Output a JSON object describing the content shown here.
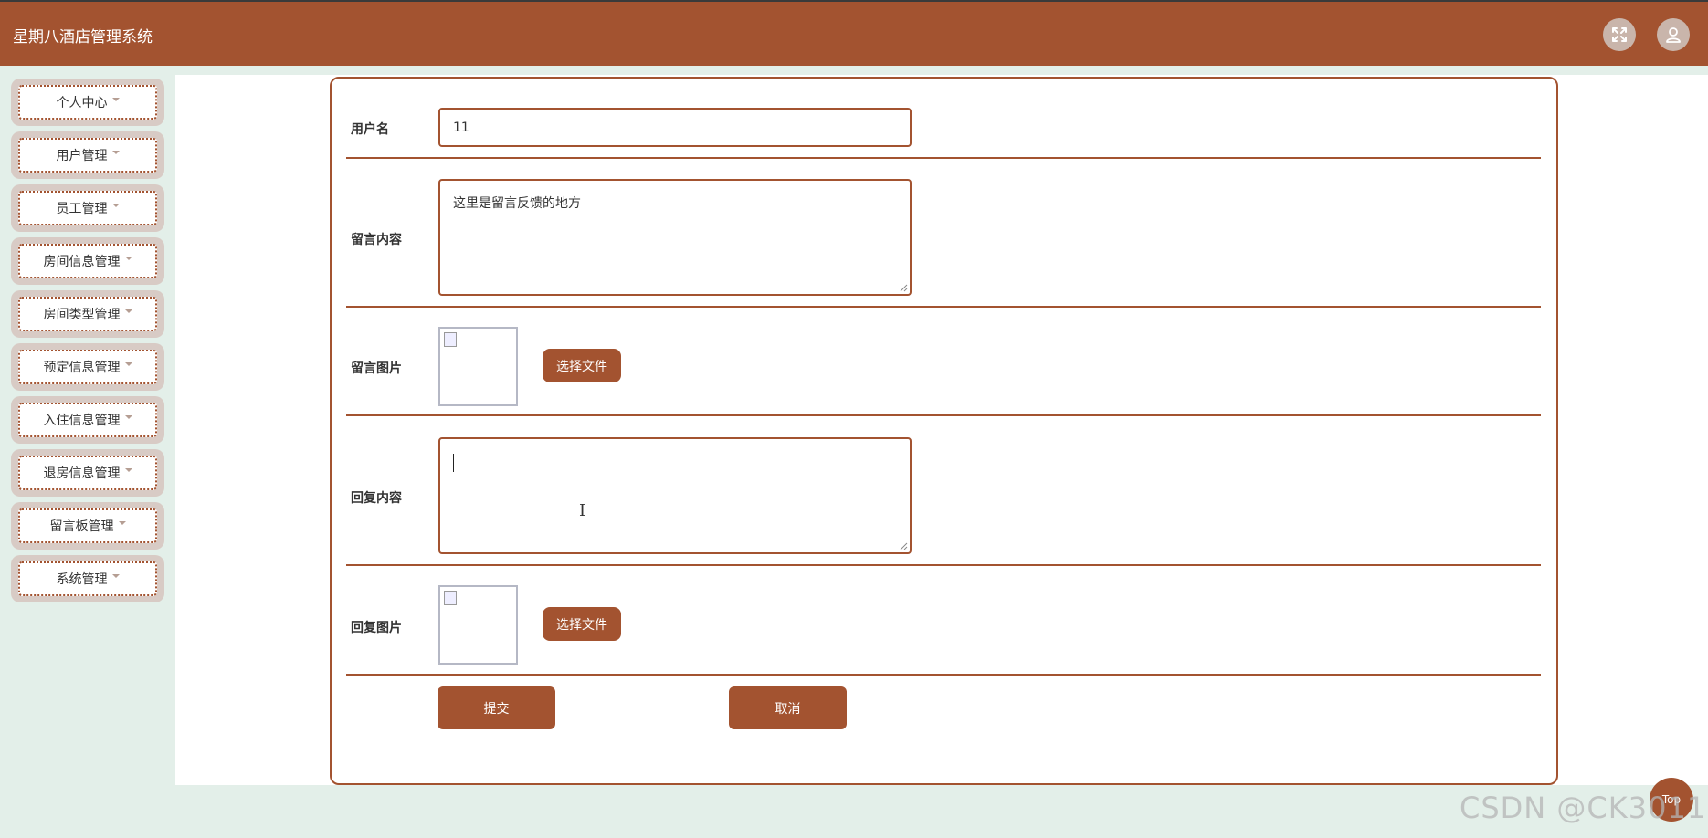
{
  "header": {
    "app_title": "星期八酒店管理系统",
    "fullscreen_icon": "fullscreen-icon",
    "user_icon": "user-icon"
  },
  "sidebar": {
    "items": [
      {
        "label": "个人中心"
      },
      {
        "label": "用户管理"
      },
      {
        "label": "员工管理"
      },
      {
        "label": "房间信息管理"
      },
      {
        "label": "房间类型管理"
      },
      {
        "label": "预定信息管理"
      },
      {
        "label": "入住信息管理"
      },
      {
        "label": "退房信息管理"
      },
      {
        "label": "留言板管理"
      },
      {
        "label": "系统管理"
      }
    ]
  },
  "form": {
    "username_label": "用户名",
    "username_value": "11",
    "message_label": "留言内容",
    "message_value": "这里是留言反馈的地方",
    "message_image_label": "留言图片",
    "message_image_button": "选择文件",
    "reply_label": "回复内容",
    "reply_value": "",
    "reply_image_label": "回复图片",
    "reply_image_button": "选择文件",
    "submit_label": "提交",
    "cancel_label": "取消"
  },
  "footer": {
    "top_button": "Top",
    "watermark": "CSDN @CK3011"
  },
  "colors": {
    "brand": "#a35330",
    "page_background": "#e3efe9"
  }
}
